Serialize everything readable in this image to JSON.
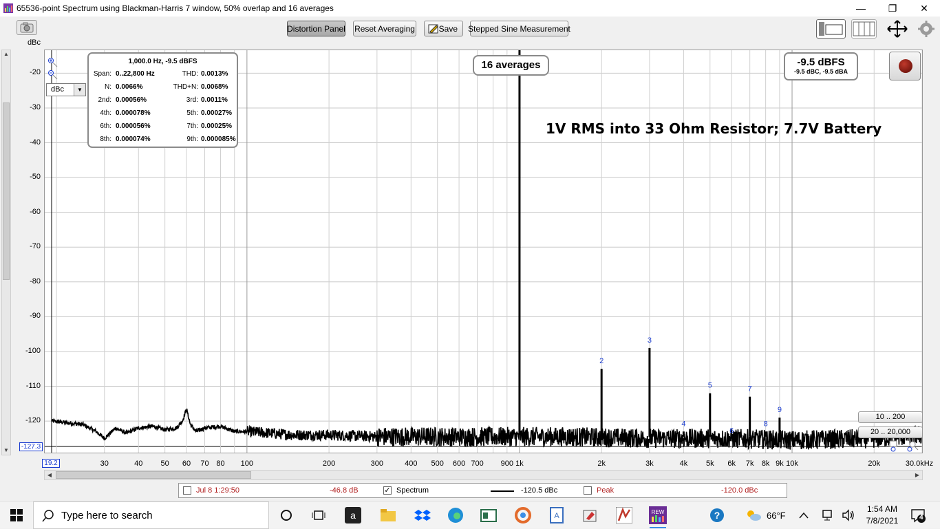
{
  "window": {
    "title": "65536-point Spectrum using Blackman-Harris 7 window, 50% overlap and 16 averages",
    "controls": [
      "—",
      "❐",
      "✕"
    ]
  },
  "toolbar": {
    "distortion_panel": "Distortion Panel",
    "reset_averaging": "Reset Averaging",
    "save": "Save",
    "stepped_sine": "Stepped Sine Measurement",
    "y_unit": "dBc"
  },
  "plot": {
    "annotation": "1V RMS into 33 Ohm Resistor; 7.7V Battery",
    "averages_badge": "16 averages",
    "level_main": "-9.5 dBFS",
    "level_sub": "-9.5 dBC, -9.5 dBA",
    "unit_select": "dBc",
    "y_min_box": "-127.3",
    "x_min_box": "19.2",
    "range_low_btn": "10 .. 200",
    "range_high_btn": "20 .. 20,000",
    "y_ticks": [
      "-20",
      "-30",
      "-40",
      "-50",
      "-60",
      "-70",
      "-80",
      "-90",
      "-100",
      "-110",
      "-120"
    ],
    "x_ticks": [
      "30",
      "40",
      "50",
      "60",
      "70",
      "80",
      "100",
      "200",
      "300",
      "400",
      "500",
      "600",
      "700",
      "900",
      "1k",
      "2k",
      "3k",
      "4k",
      "5k",
      "6k",
      "7k",
      "8k",
      "9k",
      "10k",
      "20k",
      "30.0kHz"
    ]
  },
  "distortion": {
    "header": "1,000.0 Hz, -9.5 dBFS",
    "rows": [
      {
        "k1": "Span:",
        "v1": "0..22,800 Hz",
        "k2": "THD:",
        "v2": "0.0013%"
      },
      {
        "k1": "N:",
        "v1": "0.0066%",
        "k2": "THD+N:",
        "v2": "0.0068%"
      },
      {
        "k1": "2nd:",
        "v1": "0.00056%",
        "k2": "3rd:",
        "v2": "0.0011%"
      },
      {
        "k1": "4th:",
        "v1": "0.000078%",
        "k2": "5th:",
        "v2": "0.00027%"
      },
      {
        "k1": "6th:",
        "v1": "0.000056%",
        "k2": "7th:",
        "v2": "0.00025%"
      },
      {
        "k1": "8th:",
        "v1": "0.000074%",
        "k2": "9th:",
        "v2": "0.000085%"
      }
    ]
  },
  "chart_data": {
    "type": "line",
    "title": "",
    "xlabel": "Hz",
    "ylabel": "dBc",
    "x_scale": "log",
    "xlim": [
      19.2,
      30000
    ],
    "ylim": [
      -127.3,
      -10
    ],
    "grid": true,
    "fundamental": {
      "x": 1000,
      "y": 0
    },
    "harmonics": [
      {
        "label": "2",
        "x": 2000,
        "y": -105
      },
      {
        "label": "3",
        "x": 3000,
        "y": -99
      },
      {
        "label": "4",
        "x": 4000,
        "y": -123
      },
      {
        "label": "5",
        "x": 5000,
        "y": -112
      },
      {
        "label": "6",
        "x": 6000,
        "y": -125
      },
      {
        "label": "7",
        "x": 7000,
        "y": -113
      },
      {
        "label": "8",
        "x": 8000,
        "y": -123
      },
      {
        "label": "9",
        "x": 9000,
        "y": -119
      }
    ],
    "noise_floor": [
      [
        19.2,
        -120
      ],
      [
        22,
        -120.5
      ],
      [
        25,
        -121
      ],
      [
        28,
        -123
      ],
      [
        30,
        -125
      ],
      [
        33,
        -122
      ],
      [
        36,
        -123.5
      ],
      [
        40,
        -122
      ],
      [
        45,
        -121.5
      ],
      [
        50,
        -122.5
      ],
      [
        55,
        -122
      ],
      [
        58,
        -120
      ],
      [
        60,
        -116.5
      ],
      [
        62,
        -121
      ],
      [
        65,
        -123
      ],
      [
        70,
        -122
      ],
      [
        80,
        -121.5
      ],
      [
        90,
        -123
      ],
      [
        100,
        -123
      ],
      [
        150,
        -124
      ],
      [
        200,
        -124
      ],
      [
        300,
        -124.5
      ],
      [
        500,
        -124.5
      ],
      [
        900,
        -124.5
      ],
      [
        1500,
        -124.5
      ],
      [
        3000,
        -125
      ],
      [
        6000,
        -125
      ],
      [
        10000,
        -125.5
      ],
      [
        20000,
        -125
      ],
      [
        30000,
        -124
      ]
    ],
    "series": [
      {
        "name": "Spectrum",
        "legend_value": "-120.5 dBc"
      }
    ]
  },
  "legend": {
    "item1_label": "Jul 8 1:29:50",
    "item1_value": "-46.8 dB",
    "item2_label": "Spectrum",
    "item2_value": "-120.5 dBc",
    "item3_label": "Peak",
    "item3_value": "-120.0 dBc",
    "item1_color": "#b22222",
    "item3_color": "#b22222"
  },
  "taskbar": {
    "search_placeholder": "Type here to search",
    "weather": "66°F",
    "time": "1:54 AM",
    "date": "7/8/2021",
    "notifications": "4"
  }
}
